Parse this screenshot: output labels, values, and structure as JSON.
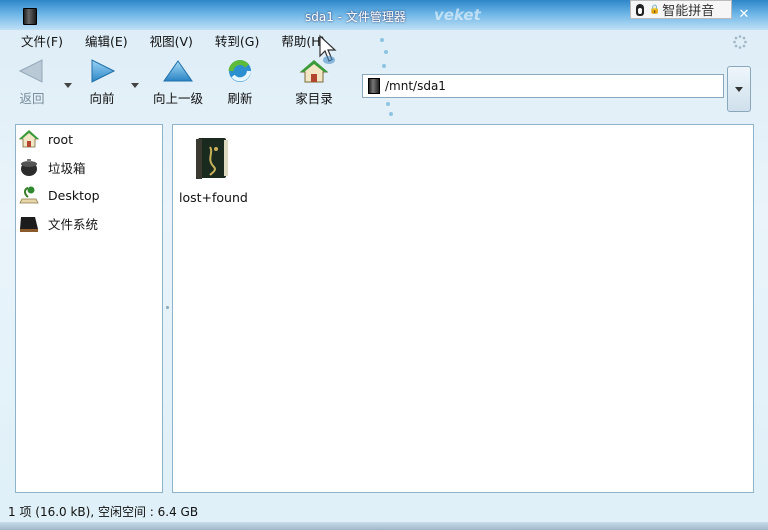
{
  "window": {
    "title": "sda1 - 文件管理器",
    "brand": "veket",
    "ime_label": "智能拼音"
  },
  "menu": [
    {
      "label": "文件(F)"
    },
    {
      "label": "编辑(E)"
    },
    {
      "label": "视图(V)"
    },
    {
      "label": "转到(G)"
    },
    {
      "label": "帮助(H)"
    }
  ],
  "toolbar": {
    "back": "返回",
    "forward": "向前",
    "up": "向上一级",
    "refresh": "刷新",
    "home": "家目录"
  },
  "location": {
    "path": "/mnt/sda1"
  },
  "sidebar": {
    "items": [
      {
        "label": "root",
        "icon": "home-icon"
      },
      {
        "label": "垃圾箱",
        "icon": "trash-icon"
      },
      {
        "label": "Desktop",
        "icon": "desktop-icon"
      },
      {
        "label": "文件系统",
        "icon": "drive-icon"
      }
    ]
  },
  "files": [
    {
      "name": "lost+found",
      "icon": "book-folder-icon"
    }
  ],
  "status": "1 项 (16.0 kB), 空闲空间 : 6.4 GB",
  "colors": {
    "titlebar": "#2e86c9",
    "accent": "#4aa3df"
  }
}
